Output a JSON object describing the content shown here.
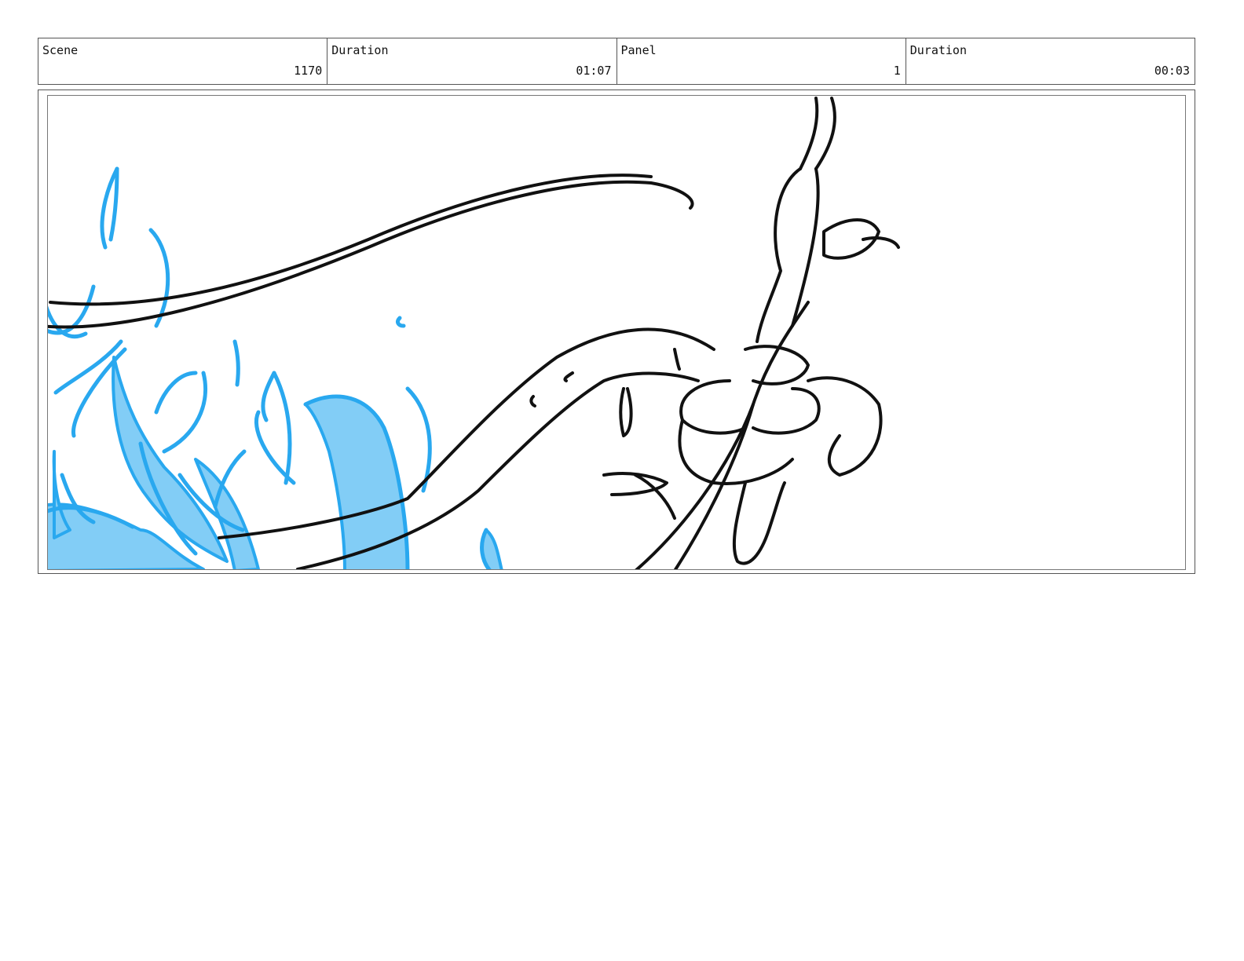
{
  "header": {
    "cells": [
      {
        "label": "Scene",
        "value": "1170"
      },
      {
        "label": "Duration",
        "value": "01:07"
      },
      {
        "label": "Panel",
        "value": "1"
      },
      {
        "label": "Duration",
        "value": "00:03"
      }
    ]
  },
  "colors": {
    "flame_stroke": "#29a8ef",
    "flame_fill": "#82cdf6",
    "ink": "#111111"
  }
}
